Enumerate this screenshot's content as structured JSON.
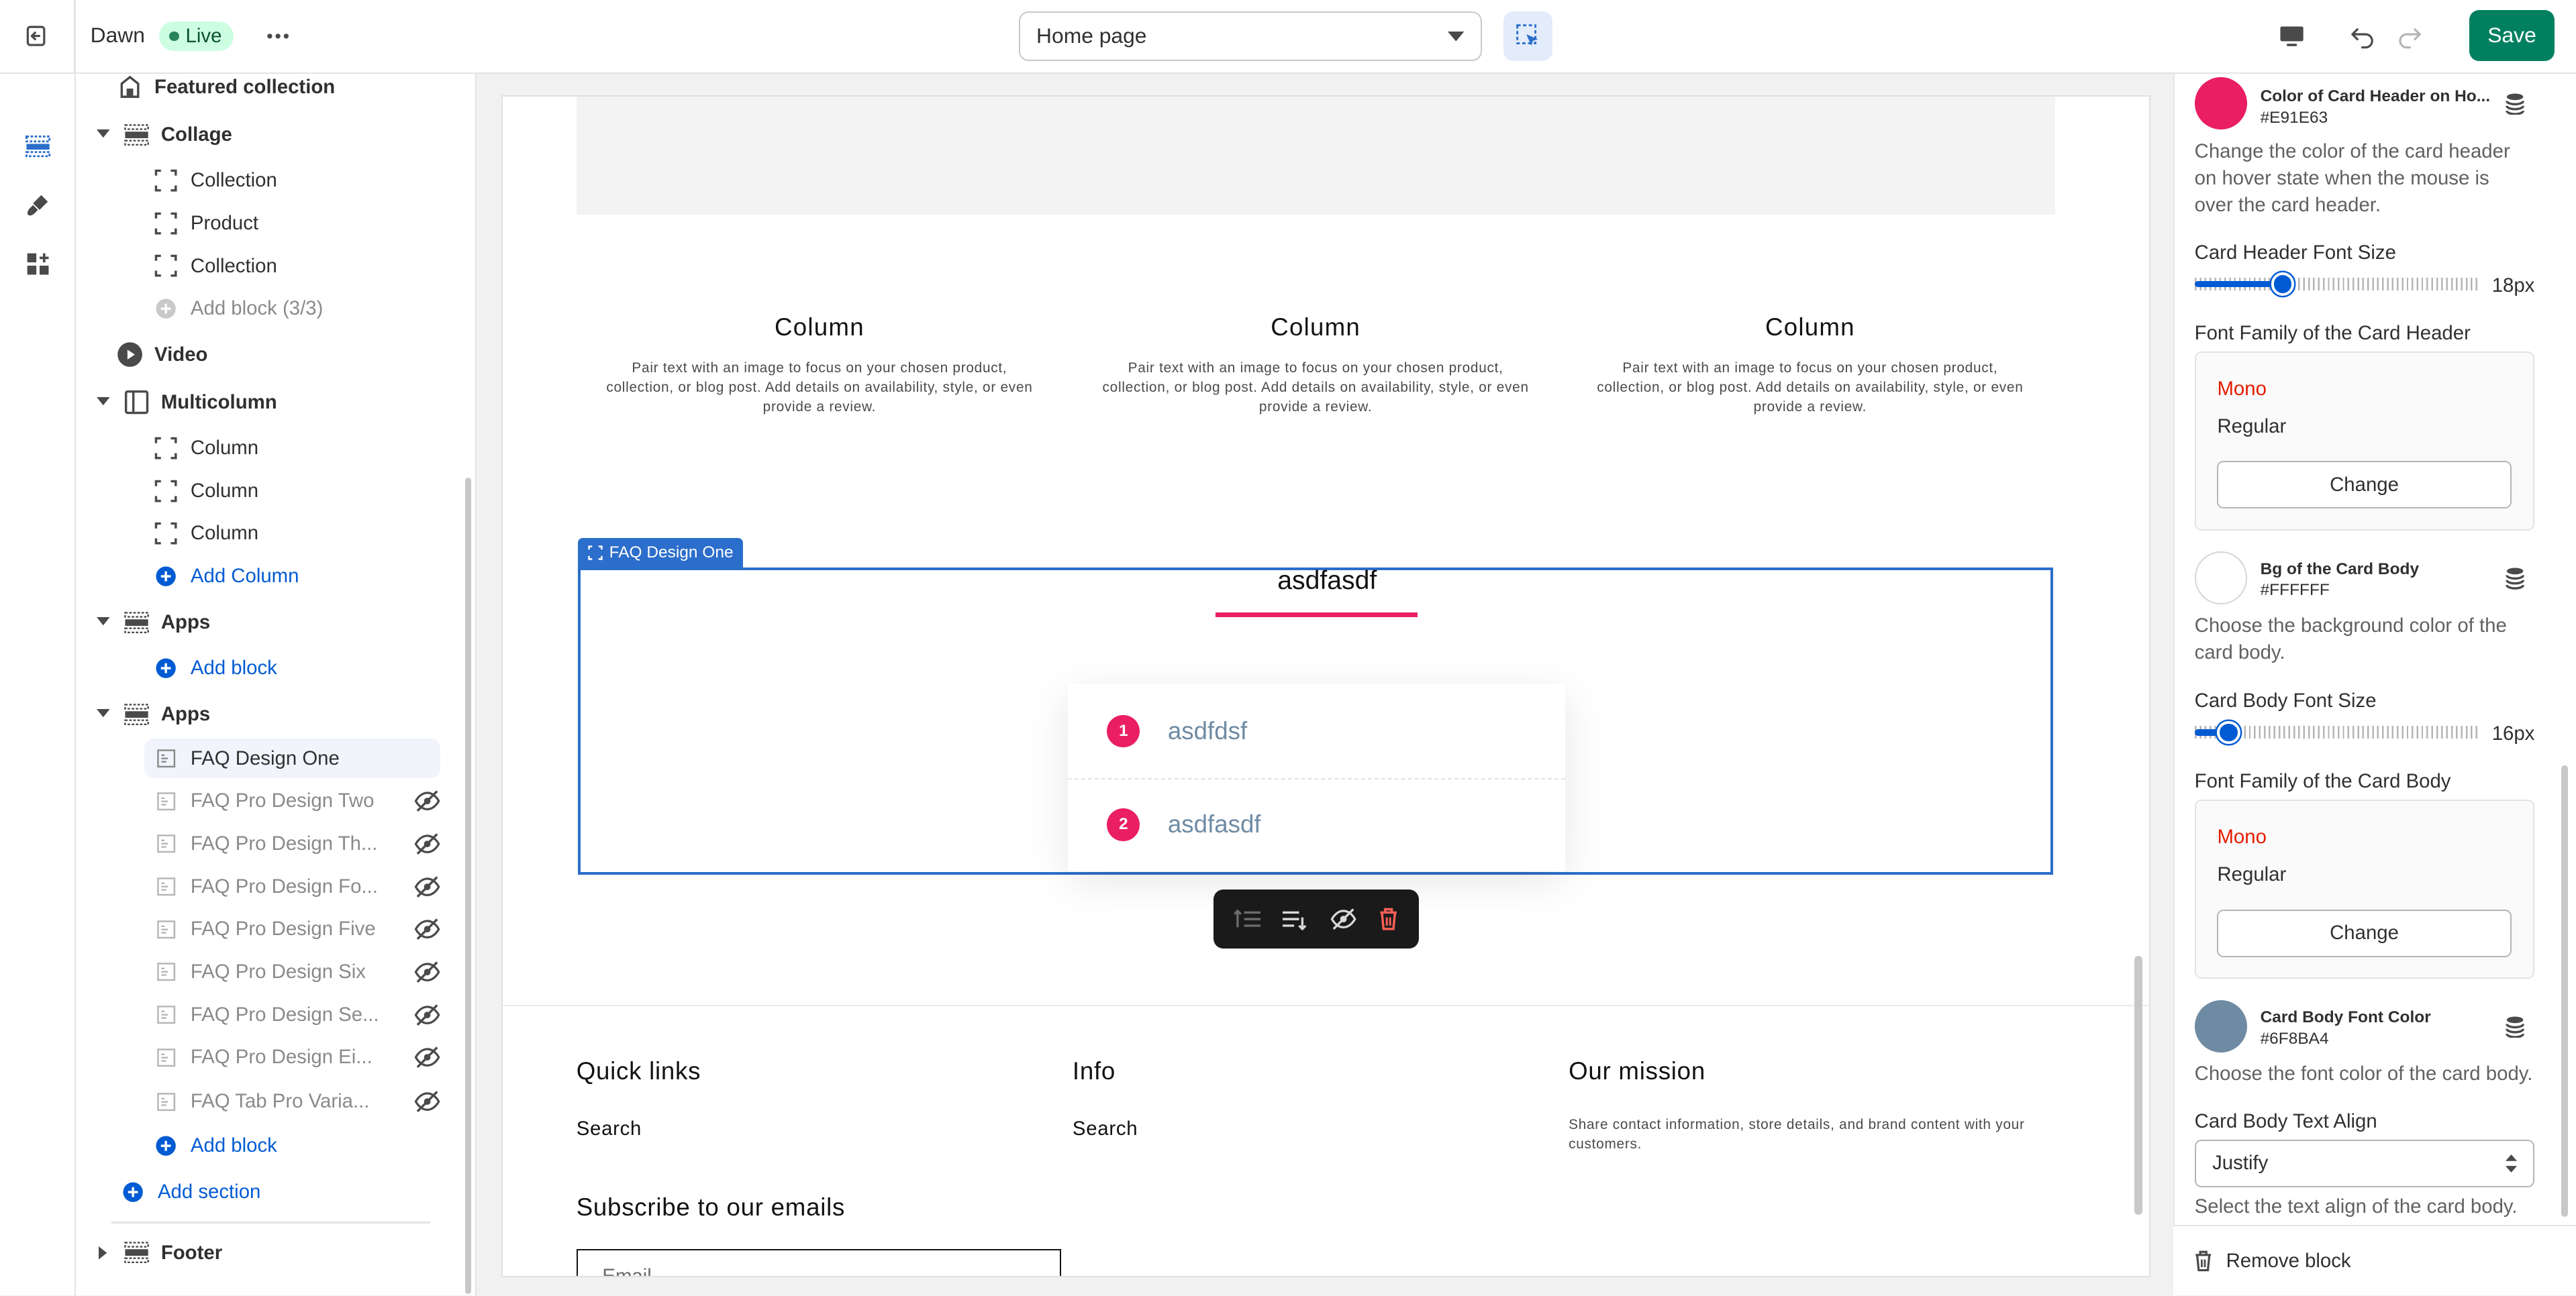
{
  "topbar": {
    "theme_name": "Dawn",
    "live_label": "Live",
    "page_selector": "Home page",
    "save_label": "Save"
  },
  "sidebar": {
    "featured_collection": "Featured collection",
    "collage": {
      "title": "Collage",
      "blocks": [
        "Collection",
        "Product",
        "Collection"
      ],
      "add_block": "Add block (3/3)"
    },
    "video": "Video",
    "multicolumn": {
      "title": "Multicolumn",
      "blocks": [
        "Column",
        "Column",
        "Column"
      ],
      "add_column": "Add Column"
    },
    "apps1": {
      "title": "Apps",
      "add_block": "Add block"
    },
    "apps2": {
      "title": "Apps",
      "blocks": [
        {
          "label": "FAQ Design One",
          "hidden": false
        },
        {
          "label": "FAQ Pro Design Two",
          "hidden": true
        },
        {
          "label": "FAQ Pro Design Th...",
          "hidden": true
        },
        {
          "label": "FAQ Pro Design Fo...",
          "hidden": true
        },
        {
          "label": "FAQ Pro Design Five",
          "hidden": true
        },
        {
          "label": "FAQ Pro Design Six",
          "hidden": true
        },
        {
          "label": "FAQ Pro Design Se...",
          "hidden": true
        },
        {
          "label": "FAQ Pro Design Ei...",
          "hidden": true
        },
        {
          "label": "FAQ Tab Pro Varia...",
          "hidden": true
        }
      ],
      "add_block": "Add block"
    },
    "add_section": "Add section",
    "footer": "Footer"
  },
  "preview": {
    "columns": [
      {
        "title": "Column",
        "text": "Pair text with an image to focus on your chosen product, collection, or blog post. Add details on availability, style, or even provide a review."
      },
      {
        "title": "Column",
        "text": "Pair text with an image to focus on your chosen product, collection, or blog post. Add details on availability, style, or even provide a review."
      },
      {
        "title": "Column",
        "text": "Pair text with an image to focus on your chosen product, collection, or blog post. Add details on availability, style, or even provide a review."
      }
    ],
    "faq_tag": "FAQ Design One",
    "faq_title": "asdfasdf",
    "faq_items": [
      {
        "num": "1",
        "question": "asdfdsf"
      },
      {
        "num": "2",
        "question": "asdfasdf"
      }
    ],
    "footer": {
      "quick_links_title": "Quick links",
      "quick_links_item": "Search",
      "info_title": "Info",
      "info_item": "Search",
      "mission_title": "Our mission",
      "mission_text": "Share contact information, store details, and brand content with your customers.",
      "subscribe_title": "Subscribe to our emails",
      "email_placeholder": "Email"
    }
  },
  "settings": {
    "hover_color": {
      "name": "Color of Card Header on Ho...",
      "hex": "#E91E63",
      "help": "Change the color of the card header on hover state when the mouse is over the card header."
    },
    "header_font_size": {
      "label": "Card Header Font Size",
      "value": "18px",
      "fraction": 0.31
    },
    "header_font_family": {
      "label": "Font Family of the Card Header",
      "font": "Mono",
      "style": "Regular",
      "change": "Change"
    },
    "body_bg": {
      "name": "Bg of the Card Body",
      "hex": "#FFFFFF",
      "help": "Choose the background color of the card body."
    },
    "body_font_size": {
      "label": "Card Body Font Size",
      "value": "16px",
      "fraction": 0.12
    },
    "body_font_family": {
      "label": "Font Family of the Card Body",
      "font": "Mono",
      "style": "Regular",
      "change": "Change"
    },
    "body_font_color": {
      "name": "Card Body Font Color",
      "hex": "#6F8BA4",
      "help": "Choose the font color of the card body."
    },
    "body_text_align": {
      "label": "Card Body Text Align",
      "value": "Justify",
      "help": "Select the text align of the card body."
    },
    "remove_block": "Remove block"
  }
}
